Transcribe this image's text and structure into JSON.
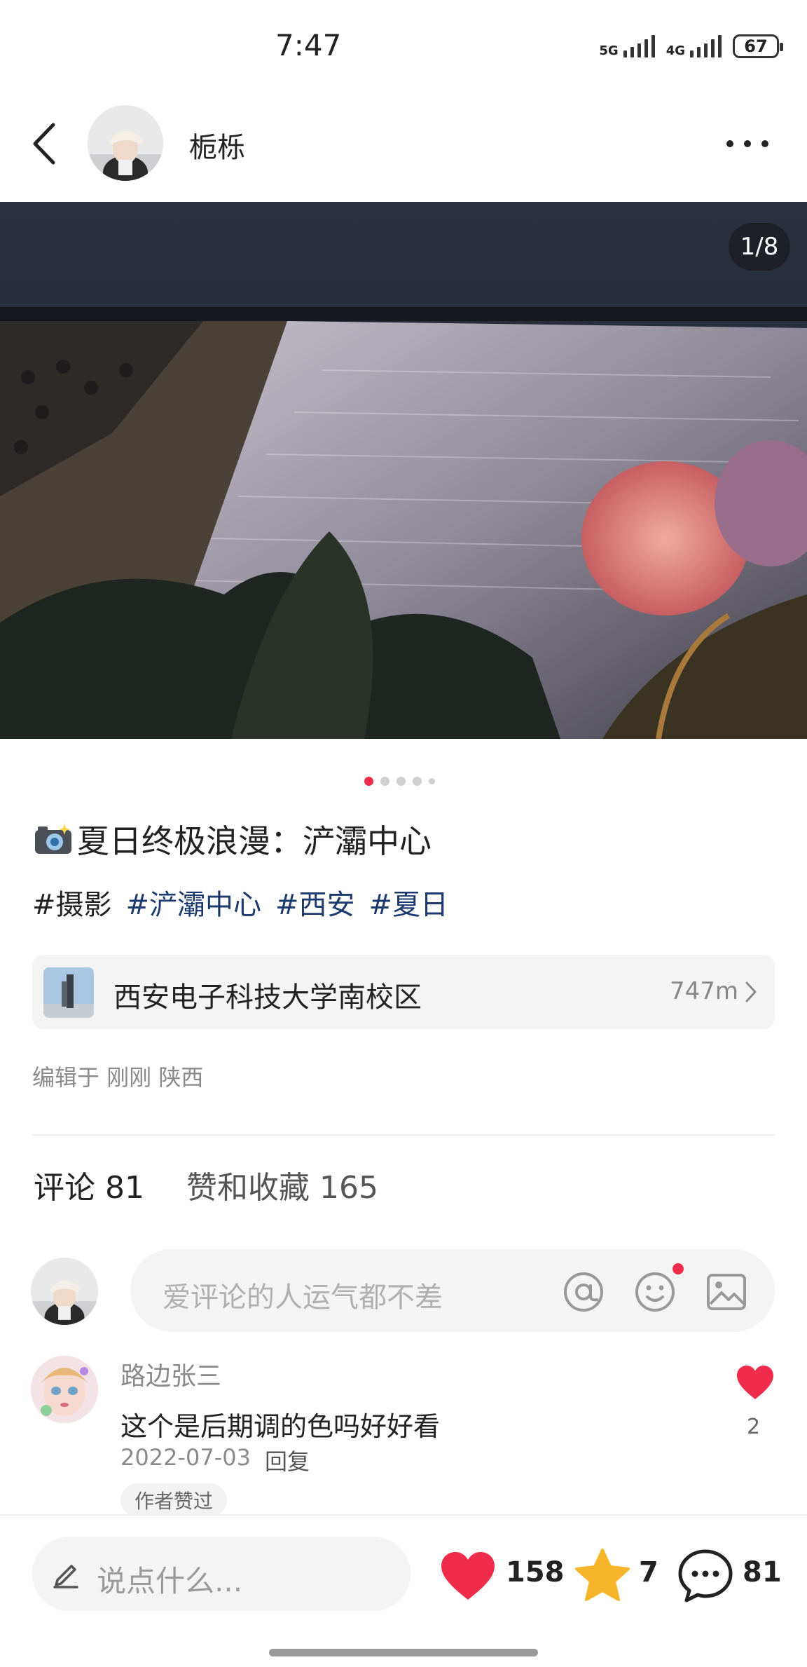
{
  "status_bar": {
    "time": "7:47",
    "network_1": "5G",
    "network_2": "4G",
    "battery": "67"
  },
  "header": {
    "author_name": "栀栎"
  },
  "post": {
    "image_counter": "1/8",
    "title": "夏日终极浪漫：浐灞中心",
    "tags": [
      "#摄影",
      "#浐灞中心",
      "#西安",
      "#夏日"
    ],
    "location": {
      "name": "西安电子科技大学南校区",
      "distance": "747m"
    },
    "edited_info": "编辑于 刚刚 陕西"
  },
  "tabs": {
    "comments": "评论 81",
    "likes_and_collects": "赞和收藏 165"
  },
  "comment_input": {
    "placeholder": "爱评论的人运气都不差"
  },
  "comments": [
    {
      "user": "路边张三",
      "text": "这个是后期调的色吗好好看",
      "date": "2022-07-03",
      "reply_label": "回复",
      "badge": "作者赞过",
      "likes": "2"
    }
  ],
  "bottom_bar": {
    "placeholder": "说点什么...",
    "like_count": "158",
    "collect_count": "7",
    "comment_count": "81"
  },
  "colors": {
    "accent": "#ef2d4b",
    "tag": "#1c3a6e",
    "star": "#f7b52b"
  },
  "icons": [
    "back-icon",
    "more-icon",
    "camera-icon",
    "chevron-right-icon",
    "at-icon",
    "emoji-icon",
    "image-icon",
    "heart-icon",
    "star-icon",
    "chat-icon",
    "pencil-icon"
  ]
}
